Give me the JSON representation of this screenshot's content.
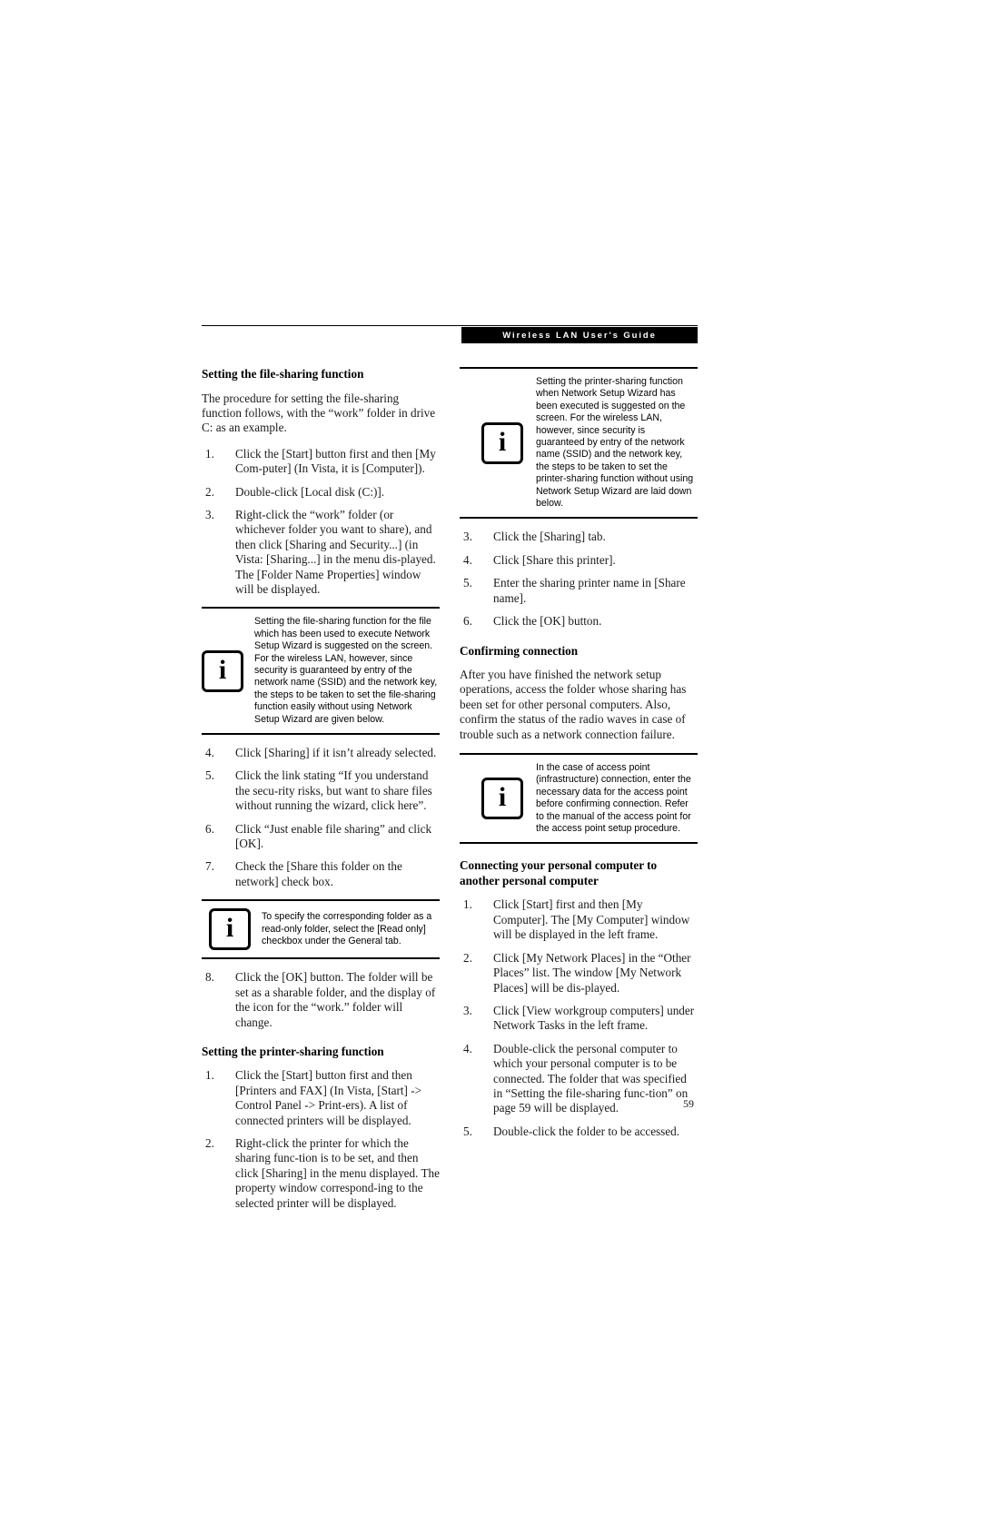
{
  "header": {
    "title": "Wireless LAN User's Guide"
  },
  "page_number": "59",
  "left_column": {
    "section1": {
      "heading": "Setting the file-sharing function",
      "intro": "The procedure for setting the file-sharing function follows, with the “work” folder in drive C: as an example.",
      "steps_a": [
        {
          "num": "1.",
          "text": "Click the [Start] button first and then [My Com-puter] (In Vista, it is [Computer])."
        },
        {
          "num": "2.",
          "text": "Double-click [Local disk (C:)]."
        },
        {
          "num": "3.",
          "text": "Right-click the “work” folder (or whichever folder you want to share), and then click [Sharing and Security...] (in Vista: [Sharing...] in the menu dis-played. The [Folder Name Properties] window will be displayed."
        }
      ],
      "note_a": {
        "icon": "info-icon",
        "text": "Setting the file-sharing function for the file which has been used to execute Network Setup Wizard is suggested on the screen. For the wireless LAN, however, since security is guaranteed by entry of the network name (SSID) and the network key, the steps to be taken to set the file-sharing function easily without using Network Setup Wizard are given below."
      },
      "steps_b": [
        {
          "num": "4.",
          "text": "Click [Sharing] if it isn’t already selected."
        },
        {
          "num": "5.",
          "text": "Click the link stating “If you understand the secu-rity risks, but want to share files without running the wizard, click here”."
        },
        {
          "num": "6.",
          "text": "Click “Just enable file sharing” and click [OK]."
        },
        {
          "num": "7.",
          "text": "Check the [Share this folder on the network] check box."
        }
      ],
      "note_b": {
        "icon": "info-icon",
        "text": "To specify the corresponding folder as a read-only folder, select the [Read only] checkbox under the General tab."
      },
      "steps_c": [
        {
          "num": "8.",
          "text": "Click the [OK] button. The folder will be set as a sharable folder, and the display of the icon for the “work.” folder will change."
        }
      ]
    },
    "section2": {
      "heading": "Setting the printer-sharing function",
      "steps": [
        {
          "num": "1.",
          "text": "Click the [Start] button first and then [Printers and FAX] (In Vista, [Start] -> Control Panel -> Print-ers). A list of connected printers will be displayed."
        },
        {
          "num": "2.",
          "text": "Right-click the printer for which the sharing func-tion is to be set, and then click [Sharing] in the menu displayed. The property window correspond-ing to the selected printer will be displayed."
        }
      ]
    }
  },
  "right_column": {
    "note_top": {
      "icon": "info-icon",
      "text": "Setting the printer-sharing function when Network Setup Wizard has been executed is suggested on the screen. For the wireless LAN, however, since security is guaranteed by entry of the network name (SSID) and the network key, the steps to be taken to set the printer-sharing function without using Network Setup Wizard are laid down below."
    },
    "steps_printer": [
      {
        "num": "3.",
        "text": "Click the [Sharing] tab."
      },
      {
        "num": "4.",
        "text": "Click [Share this printer]."
      },
      {
        "num": "5.",
        "text": "Enter the sharing printer name in [Share name]."
      },
      {
        "num": "6.",
        "text": "Click the [OK] button."
      }
    ],
    "section_confirm": {
      "heading": "Confirming connection",
      "body": "After you have finished the network setup operations, access the folder whose sharing has been set for other personal computers. Also, confirm the status of the radio waves in case of trouble such as a network connection failure.",
      "note": {
        "icon": "info-icon",
        "text": "In the case of access point (infrastructure) connection, enter the necessary data for the access point before confirming connection. Refer to the manual of the access point for the access point setup procedure."
      }
    },
    "section_connect": {
      "heading": "Connecting your personal computer to another personal computer",
      "steps": [
        {
          "num": "1.",
          "text": "Click [Start] first and then [My Computer]. The [My Computer] window will be displayed in the left frame."
        },
        {
          "num": "2.",
          "text": "Click [My Network Places] in the “Other Places” list. The window [My Network Places] will be dis-played."
        },
        {
          "num": "3.",
          "text": "Click [View workgroup computers] under Network Tasks in the left frame."
        },
        {
          "num": "4.",
          "text": "Double-click the personal computer to which your personal computer is to be connected. The folder that was specified in “Setting the file-sharing func-tion” on page 59 will be displayed."
        },
        {
          "num": "5.",
          "text": "Double-click the folder to be accessed."
        }
      ]
    }
  },
  "icons": {
    "info_glyph": "i"
  }
}
